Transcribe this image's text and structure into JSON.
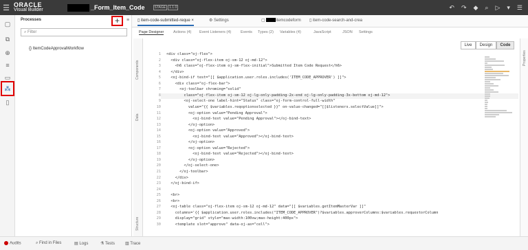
{
  "header": {
    "brand": "ORACLE",
    "product": "Visual Builder",
    "project": "_Form_Item_Code",
    "stage": "STAGE",
    "version": "1.1.0"
  },
  "nav": {
    "title": "Processes",
    "filter_placeholder": "Filter",
    "tree_item": "{} ItemCodeApprovalWorkflow"
  },
  "tabs": [
    "item-code-submitted-reque",
    "Settings",
    "itemcodeform",
    "item-code-search-and-crea"
  ],
  "subtabs": [
    "Page Designer",
    "Actions (4)",
    "Event Listeners (4)",
    "Events",
    "Types (2)",
    "Variables (4)",
    "JavaScript",
    "JSON",
    "Settings"
  ],
  "view": {
    "live": "Live",
    "design": "Design",
    "code": "Code"
  },
  "side_labels": {
    "components": "Components",
    "data": "Data",
    "structure": "Structure",
    "properties": "Properties"
  },
  "code_lines": [
    "<div class=\"oj-flex\">",
    "  <div class=\"oj-flex-item oj-sm-12 oj-md-12\">",
    "    <h6 class=\"oj-flex-item oj-sm-flex-initial\">Submitted Item Code Request</h6>",
    "  </div>",
    "  <oj-bind-if test=\"[[ $application.user.roles.includes('ITEM_CODE_APPROVER') ]]\">",
    "    <div class=\"oj-flex-bar\">",
    "      <oj-toolbar chroming=\"solid\"",
    "        class=\"oj-flex-item oj-sm-12 oj-lg-only-padding-2x-end oj-lg-only-padding-3x-bottom oj-md-12\">",
    "        <oj-select-one label-hint=\"Status\" class=\"oj-form-control-full-width\"",
    "          value=\"{{ $variables.reqoptionselected }}\" on-value-changed=\"[[$listeners.selectValue]]\">",
    "          <oj-option value=\"Pending Approval\">",
    "            <oj-bind-text value=\"Pending Approval\"></oj-bind-text>",
    "          </oj-option>",
    "          <oj-option value=\"Approved\">",
    "            <oj-bind-text value=\"Approved\"></oj-bind-text>",
    "          </oj-option>",
    "          <oj-option value=\"Rejected\">",
    "            <oj-bind-text value=\"Rejected\"></oj-bind-text>",
    "          </oj-option>",
    "        </oj-select-one>",
    "      </oj-toolbar>",
    "    </div>",
    "  </oj-bind-if>",
    "",
    "  <br>",
    "  <br>",
    "  <oj-table class=\"oj-flex-item oj-sm-12 oj-md-12\" data=\"[[ $variables.getItemMasterVar ]]\"",
    "    columns='{{ $application.user.roles.includes(\"ITEM_CODE_APPROVER\")?$variables.approverColumns:$variables.requestorColumn",
    "    display=\"grid\" style=\"max-width:100vw;max-height:400px\">",
    "    <template slot=\"approve\" data-oj-as=\"cell\">"
  ],
  "footer": [
    "Audits",
    "Find in Files",
    "Logs",
    "Tests",
    "Trace"
  ]
}
